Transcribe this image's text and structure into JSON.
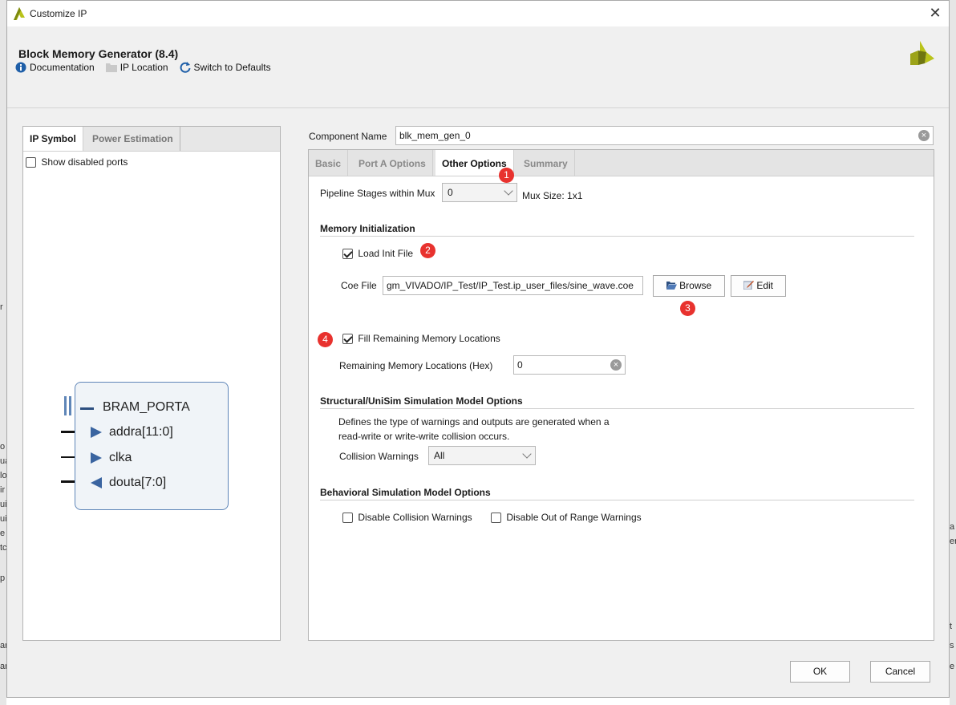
{
  "window": {
    "title": "Customize IP",
    "close_glyph": "✕"
  },
  "header": {
    "ip_name": "Block Memory Generator (8.4)"
  },
  "toolbar": {
    "documentation": "Documentation",
    "ip_location": "IP Location",
    "switch_defaults": "Switch to Defaults"
  },
  "left_panel": {
    "tabs": [
      "IP Symbol",
      "Power Estimation"
    ],
    "show_disabled_ports": "Show disabled ports",
    "symbol": {
      "bus": "BRAM_PORTA",
      "pins": [
        "addra[11:0]",
        "clka",
        "douta[7:0]"
      ]
    }
  },
  "component": {
    "label": "Component Name",
    "value": "blk_mem_gen_0"
  },
  "tabs": [
    "Basic",
    "Port A Options",
    "Other Options",
    "Summary"
  ],
  "other_options": {
    "pipeline_label": "Pipeline Stages within Mux",
    "pipeline_value": "0",
    "mux_size": "Mux Size: 1x1",
    "mem_init_section": "Memory Initialization",
    "load_init_file": "Load Init File",
    "coe_label": "Coe File",
    "coe_value": "gm_VIVADO/IP_Test/IP_Test.ip_user_files/sine_wave.coe",
    "browse": "Browse",
    "edit": "Edit",
    "fill_remaining": "Fill Remaining Memory Locations",
    "remaining_label": "Remaining Memory Locations (Hex)",
    "remaining_value": "0",
    "structural_section": "Structural/UniSim Simulation Model Options",
    "structural_desc_1": "Defines the type of warnings and outputs are generated when a",
    "structural_desc_2": "read-write or write-write collision occurs.",
    "collision_label": "Collision Warnings",
    "collision_value": "All",
    "behavioral_section": "Behavioral Simulation Model Options",
    "disable_collision": "Disable Collision Warnings",
    "disable_range": "Disable Out of Range Warnings"
  },
  "annotations": [
    "1",
    "2",
    "3",
    "4"
  ],
  "footer": {
    "ok": "OK",
    "cancel": "Cancel"
  },
  "background_fragments": {
    "left": [
      "r",
      "o",
      "ua",
      "lo",
      "ir",
      "ui",
      "ui",
      "e",
      "tc",
      "p",
      "ar",
      "ar"
    ],
    "right": [
      "a",
      "er",
      "t",
      "s",
      "e"
    ]
  },
  "colors": {
    "badge": "#e8322e",
    "symbol_border": "#5f86b8",
    "xilinx_logo": "#b9c31a"
  },
  "icons": [
    "info-icon",
    "folder-icon",
    "refresh-icon",
    "clear-icon",
    "chevron-down-icon",
    "folder-open-icon",
    "edit-icon"
  ]
}
